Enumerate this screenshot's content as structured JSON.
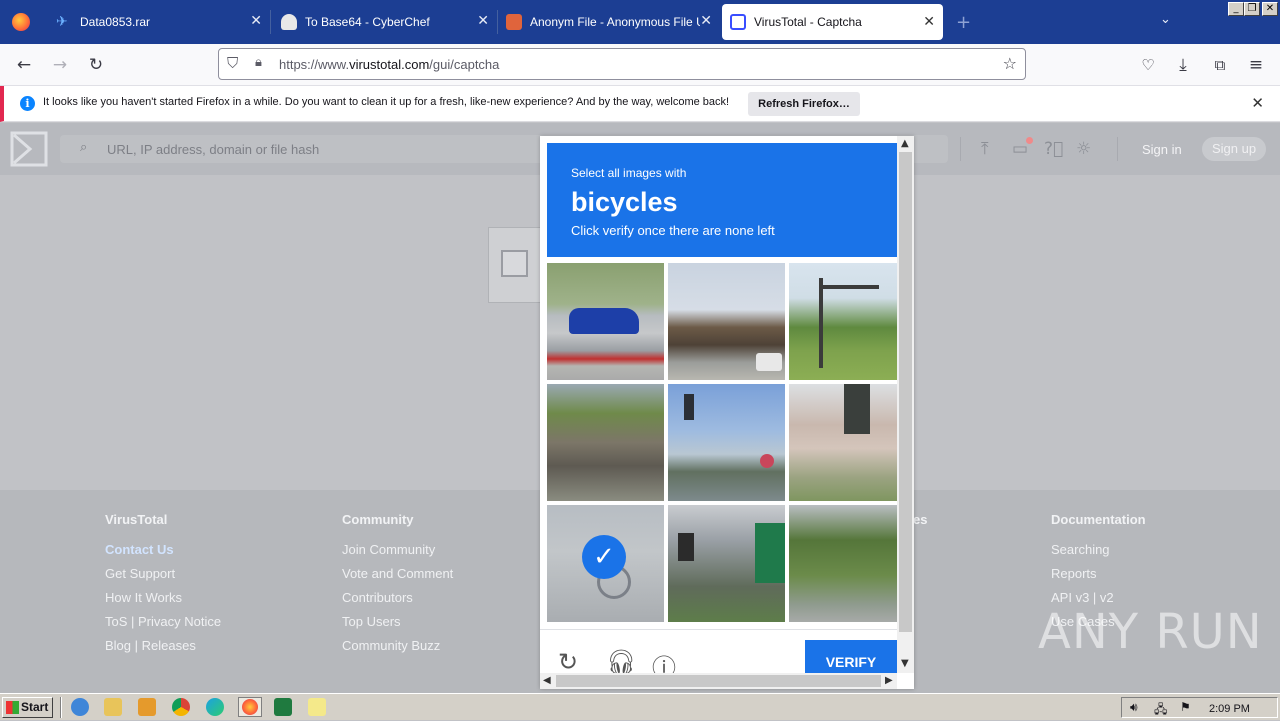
{
  "tabs": [
    {
      "title": "Data0853.rar",
      "icon": "paper-plane-icon"
    },
    {
      "title": "To Base64 - CyberChef",
      "icon": "chef-hat-icon"
    },
    {
      "title": "Anonym File - Anonymous File Uplo",
      "icon": "anonym-file-icon"
    },
    {
      "title": "VirusTotal - Captcha",
      "icon": "virustotal-icon"
    }
  ],
  "url": {
    "prefix": "https://www.",
    "domain": "virustotal.com",
    "path": "/gui/captcha"
  },
  "notification": {
    "message": "It looks like you haven't started Firefox in a while. Do you want to clean it up for a fresh, like-new experience? And by the way, welcome back!",
    "button": "Refresh Firefox…"
  },
  "vt_header": {
    "search_placeholder": "URL, IP address, domain or file hash",
    "sign_in": "Sign in",
    "sign_up": "Sign up"
  },
  "captcha": {
    "prompt_line1": "Select all images with",
    "prompt_object": "bicycles",
    "prompt_line3": "Click verify once there are none left",
    "verify_label": "VERIFY",
    "selected_tiles": [
      7
    ]
  },
  "footer": {
    "columns": [
      {
        "heading": "VirusTotal",
        "links": [
          "Contact Us",
          "Get Support",
          "How It Works",
          "ToS | Privacy Notice",
          "Blog | Releases"
        ]
      },
      {
        "heading": "Community",
        "links": [
          "Join Community",
          "Vote and Comment",
          "Contributors",
          "Top Users",
          "Community Buzz"
        ]
      },
      {
        "heading": "es",
        "links": []
      },
      {
        "heading": "Documentation",
        "links": [
          "Searching",
          "Reports",
          "API v3 | v2",
          "Use Cases"
        ]
      }
    ]
  },
  "watermark": "ANY RUN",
  "taskbar": {
    "start": "Start",
    "clock": "2:09 PM"
  },
  "colors": {
    "tabstrip": "#1c3e93",
    "captcha_blue": "#1a73e8",
    "notif_accent": "#e22850"
  }
}
